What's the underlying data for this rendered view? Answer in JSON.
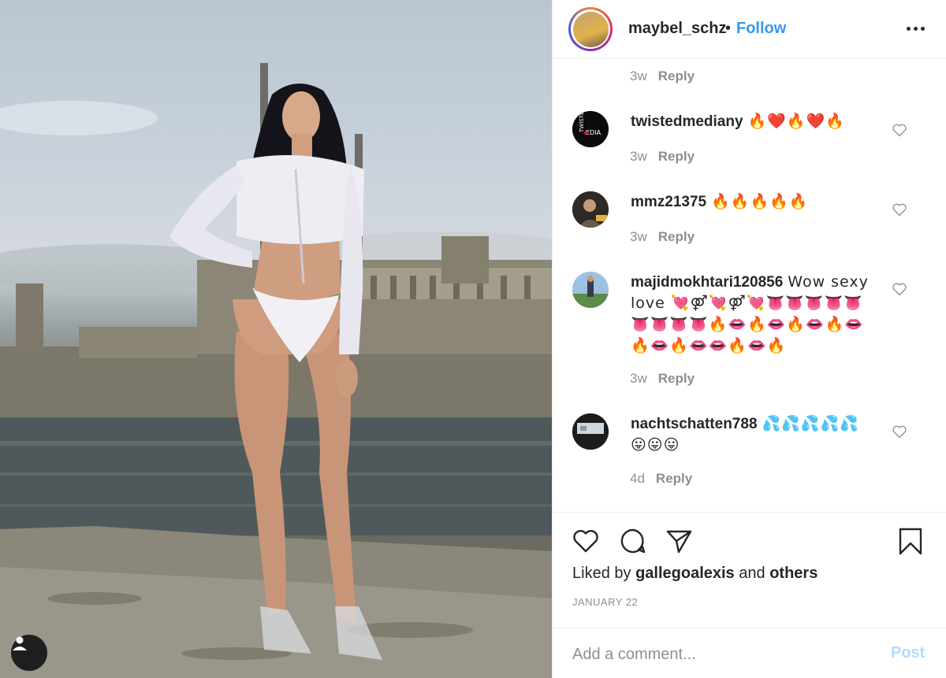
{
  "post": {
    "username": "maybel_schz",
    "separator": "•",
    "follow_label": "Follow",
    "more_label": "More options"
  },
  "comments": {
    "top_partial": {
      "time": "3w",
      "reply": "Reply"
    },
    "items": [
      {
        "username": "twistedmediany",
        "text": "🔥❤️🔥❤️🔥",
        "time": "3w",
        "reply": "Reply"
      },
      {
        "username": "mmz21375",
        "text": "🔥🔥🔥🔥🔥",
        "time": "3w",
        "reply": "Reply"
      },
      {
        "username": "majidmokhtari120856",
        "text": "Wow sexy love 💘⚤💘⚤💘👅👅👅👅👅👅👅👅👅🔥👄🔥👄🔥👄🔥👄🔥👄🔥👄👄🔥👄🔥",
        "time": "3w",
        "reply": "Reply"
      },
      {
        "username": "nachtschatten788",
        "text": "💦💦💦💦💦😛😛😛",
        "time": "4d",
        "reply": "Reply"
      }
    ]
  },
  "actions": {
    "liked_prefix": "Liked by",
    "liked_user": "gallegoalexis",
    "liked_and": "and",
    "liked_others": "others",
    "date": "JANUARY 22"
  },
  "composer": {
    "placeholder": "Add a comment...",
    "post_label": "Post"
  },
  "colors": {
    "accent": "#3897f0",
    "post_disabled": "#b3dbff",
    "muted": "#8e8e8e"
  }
}
